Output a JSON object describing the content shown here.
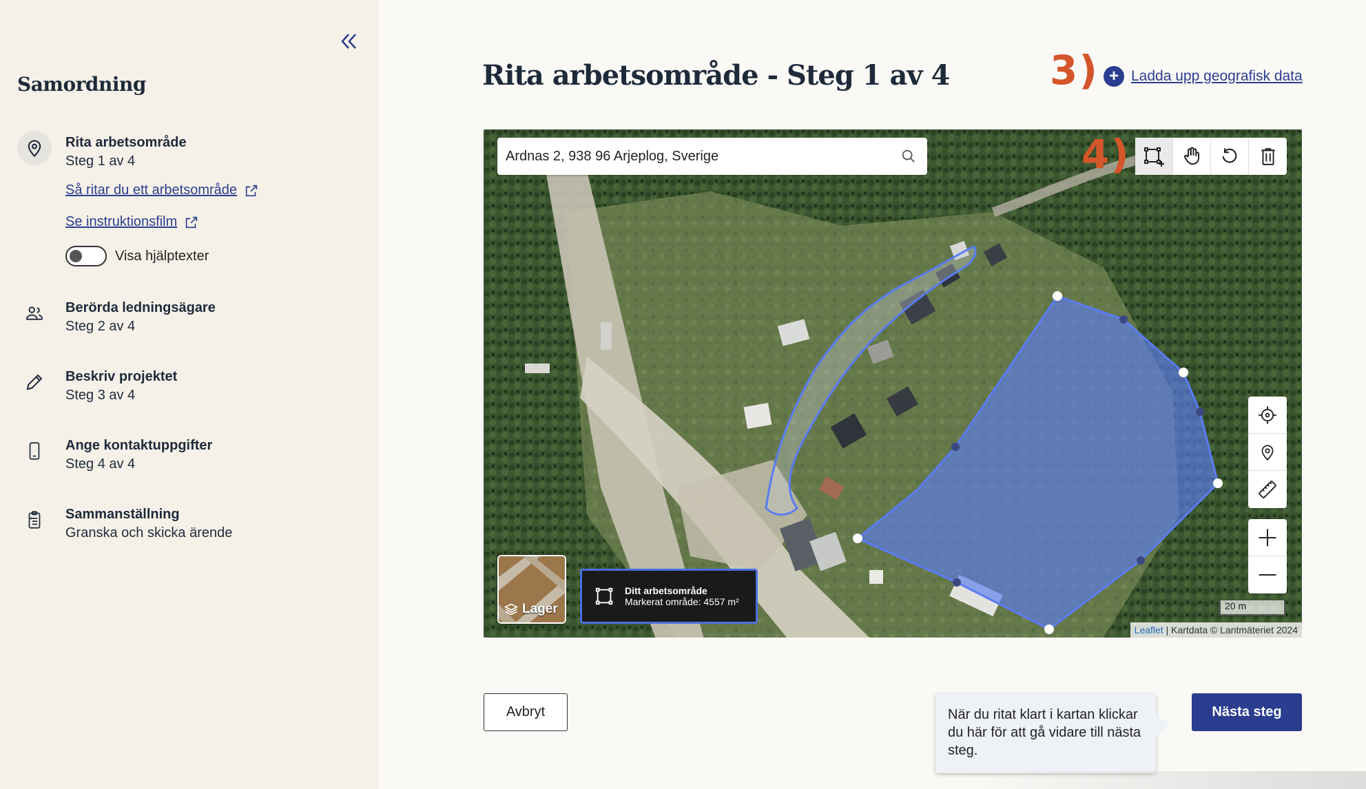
{
  "sidebar": {
    "title": "Samordning",
    "collapse_icon": "chevrons-left-icon",
    "steps": [
      {
        "title": "Rita arbetsområde",
        "sub": "Steg 1 av 4",
        "icon": "map-pin-icon",
        "active": true
      },
      {
        "title": "Berörda ledningsägare",
        "sub": "Steg 2 av 4",
        "icon": "users-icon"
      },
      {
        "title": "Beskriv projektet",
        "sub": "Steg 3 av 4",
        "icon": "pencil-icon"
      },
      {
        "title": "Ange kontaktuppgifter",
        "sub": "Steg 4 av 4",
        "icon": "phone-icon"
      },
      {
        "title": "Sammanställning",
        "sub": "Granska och skicka ärende",
        "icon": "clipboard-icon"
      }
    ],
    "links": [
      {
        "label": "Så ritar du ett arbetsområde"
      },
      {
        "label": "Se instruktionsfilm"
      }
    ],
    "toggle_label": "Visa hjälptexter",
    "toggle_on": false
  },
  "main": {
    "title": "Rita arbetsområde - Steg 1 av 4",
    "annotation_3": "3)",
    "annotation_4": "4)",
    "upload_label": "Ladda upp geografisk data"
  },
  "map": {
    "search_value": "Ardnas 2, 938 96 Arjeplog, Sverige",
    "layer_label": "Lager",
    "area_title": "Ditt arbetsområde",
    "area_sub": "Markerat område: 4557 m²",
    "scale_label": "20 m",
    "attribution_leaflet": "Leaflet",
    "attribution_rest": " | Kartdata © Lantmäteriet 2024",
    "colors": {
      "polygon": "#5b7cf0",
      "accent": "#2a3d8f",
      "annotation": "#d4562a"
    }
  },
  "footer": {
    "cancel_label": "Avbryt",
    "next_label": "Nästa steg",
    "tooltip": "När du ritat klart i kartan klickar du här för att gå vidare till nästa steg."
  }
}
